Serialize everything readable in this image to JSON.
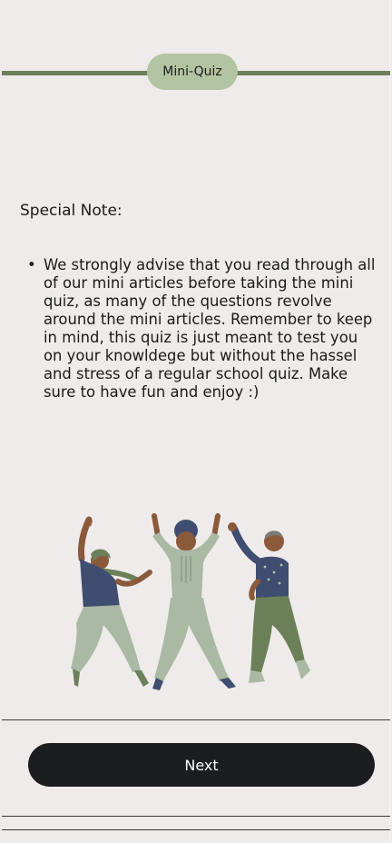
{
  "header": {
    "title": "Mini-Quiz"
  },
  "note": {
    "label": "Special Note:",
    "bullet_glyph": "•",
    "items": [
      "We strongly advise that you read through all of our mini articles before taking the mini quiz, as many of the questions revolve around the mini articles. Remember to keep in mind, this quiz is just meant to test you on your knowldege but without the hassel and stress of a regular school quiz. Make sure to have fun and enjoy :)"
    ]
  },
  "illustration": {
    "subject": "three-dancing-people-icon"
  },
  "footer": {
    "next_label": "Next"
  },
  "colors": {
    "background": "#efebea",
    "accent_green": "#6b8058",
    "pill_green": "#b3c4a2",
    "button_dark": "#1b1d1f"
  }
}
